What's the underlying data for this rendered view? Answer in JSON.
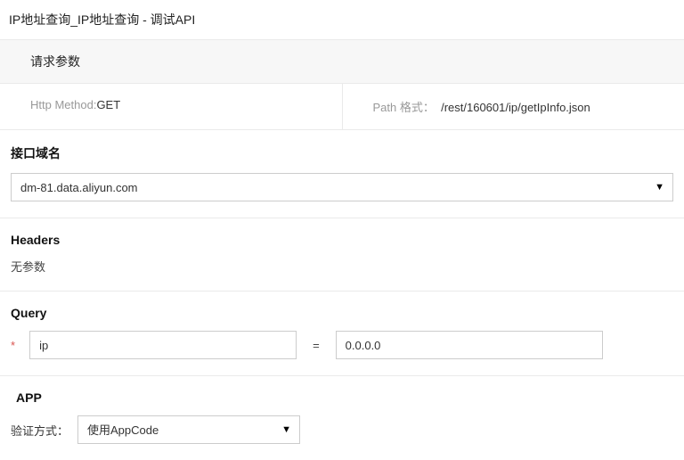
{
  "page_title": "IP地址查询_IP地址查询 - 调试API",
  "request_params_header": "请求参数",
  "http_method_label": "Http Method:",
  "http_method_value": "GET",
  "path_label": "Path 格式：",
  "path_value": "/rest/160601/ip/getIpInfo.json",
  "domain_section": {
    "label": "接口域名",
    "selected": "dm-81.data.aliyun.com"
  },
  "headers_section": {
    "label": "Headers",
    "text": "无参数"
  },
  "query_section": {
    "label": "Query",
    "required_mark": "*",
    "param_key": "ip",
    "equals": "=",
    "param_value": "0.0.0.0"
  },
  "app_section": {
    "label": "APP",
    "auth_label": "验证方式：",
    "auth_selected": "使用AppCode"
  }
}
